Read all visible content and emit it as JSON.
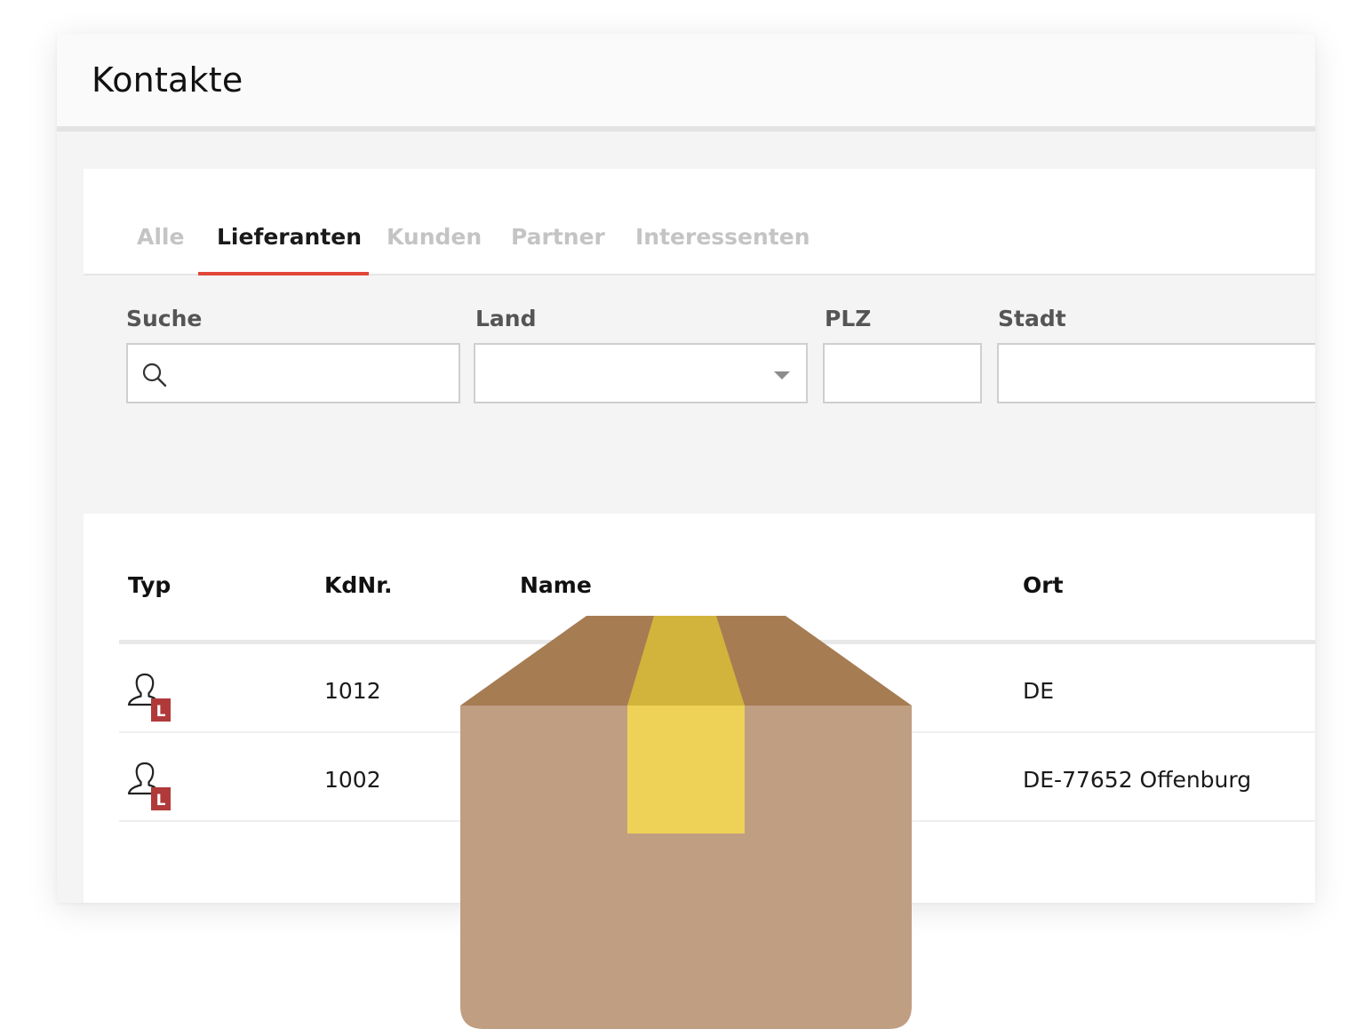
{
  "page": {
    "title": "Kontakte"
  },
  "tabs": [
    {
      "label": "Alle",
      "active": false
    },
    {
      "label": "Lieferanten",
      "active": true
    },
    {
      "label": "Kunden",
      "active": false
    },
    {
      "label": "Partner",
      "active": false
    },
    {
      "label": "Interessenten",
      "active": false
    }
  ],
  "filters": {
    "search": {
      "label": "Suche",
      "value": "",
      "icon": "search-icon"
    },
    "country": {
      "label": "Land",
      "value": "",
      "icon": "chevron-down-icon"
    },
    "zip": {
      "label": "PLZ",
      "value": ""
    },
    "city": {
      "label": "Stadt",
      "value": ""
    }
  },
  "table": {
    "columns": [
      "Typ",
      "KdNr.",
      "Name",
      "Ort"
    ],
    "rows": [
      {
        "type_badge": "L",
        "type_icon": "supplier-user-icon",
        "number": "1012",
        "name": "",
        "location": "DE"
      },
      {
        "type_badge": "L",
        "type_icon": "supplier-user-icon",
        "number": "1002",
        "name": "",
        "location": "DE-77652 Offenburg"
      }
    ]
  },
  "colors": {
    "accent": "#e0473a",
    "badge": "#b03a3a",
    "box_body": "#c09e82",
    "box_flap": "#a67c53",
    "tape_top": "#d2b43c",
    "tape_front": "#edd257"
  }
}
